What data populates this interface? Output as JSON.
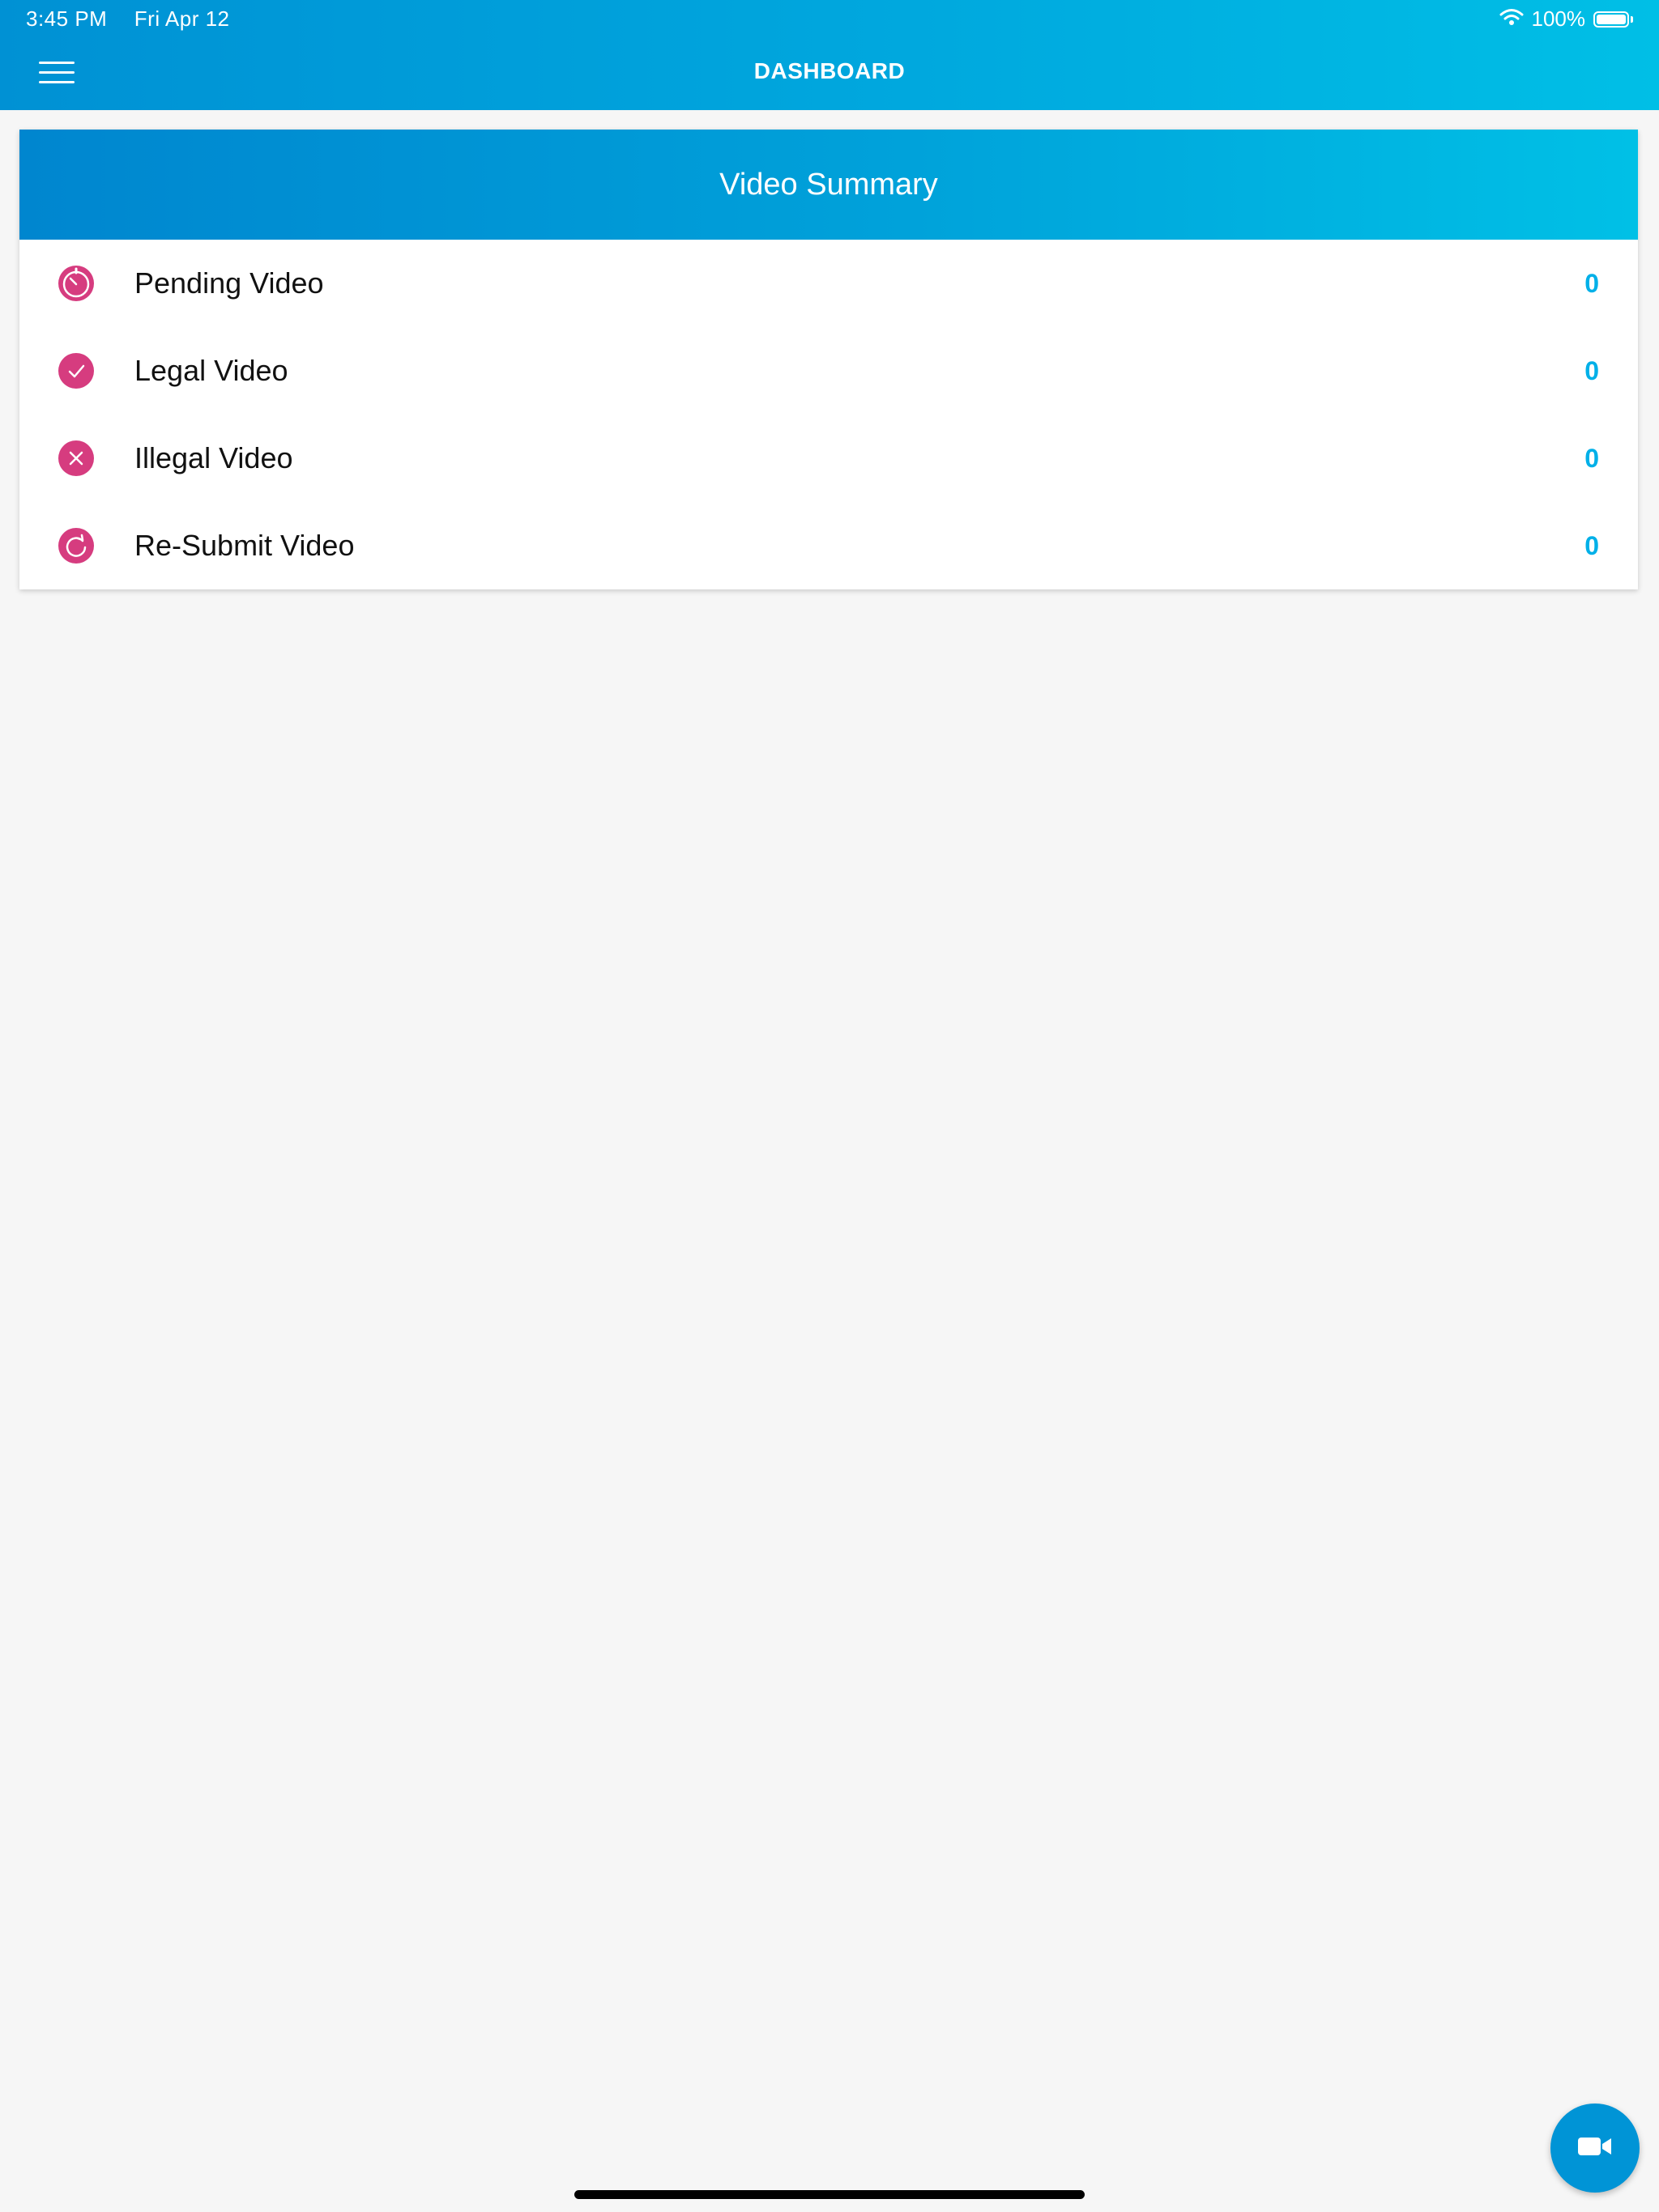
{
  "status_bar": {
    "time": "3:45 PM",
    "date": "Fri Apr 12",
    "battery": "100%"
  },
  "nav": {
    "title": "DASHBOARD"
  },
  "card": {
    "title": "Video Summary",
    "items": [
      {
        "label": "Pending Video",
        "count": "0",
        "icon": "timer-icon"
      },
      {
        "label": "Legal Video",
        "count": "0",
        "icon": "check-circle-icon"
      },
      {
        "label": "Illegal Video",
        "count": "0",
        "icon": "x-circle-icon"
      },
      {
        "label": "Re-Submit Video",
        "count": "0",
        "icon": "refresh-icon"
      }
    ]
  },
  "colors": {
    "accent": "#00b0e8",
    "icon_pink": "#d63c7f",
    "header_start": "#0086cf",
    "header_end": "#00c0e6"
  },
  "fab": {
    "icon": "video-camera-icon"
  }
}
